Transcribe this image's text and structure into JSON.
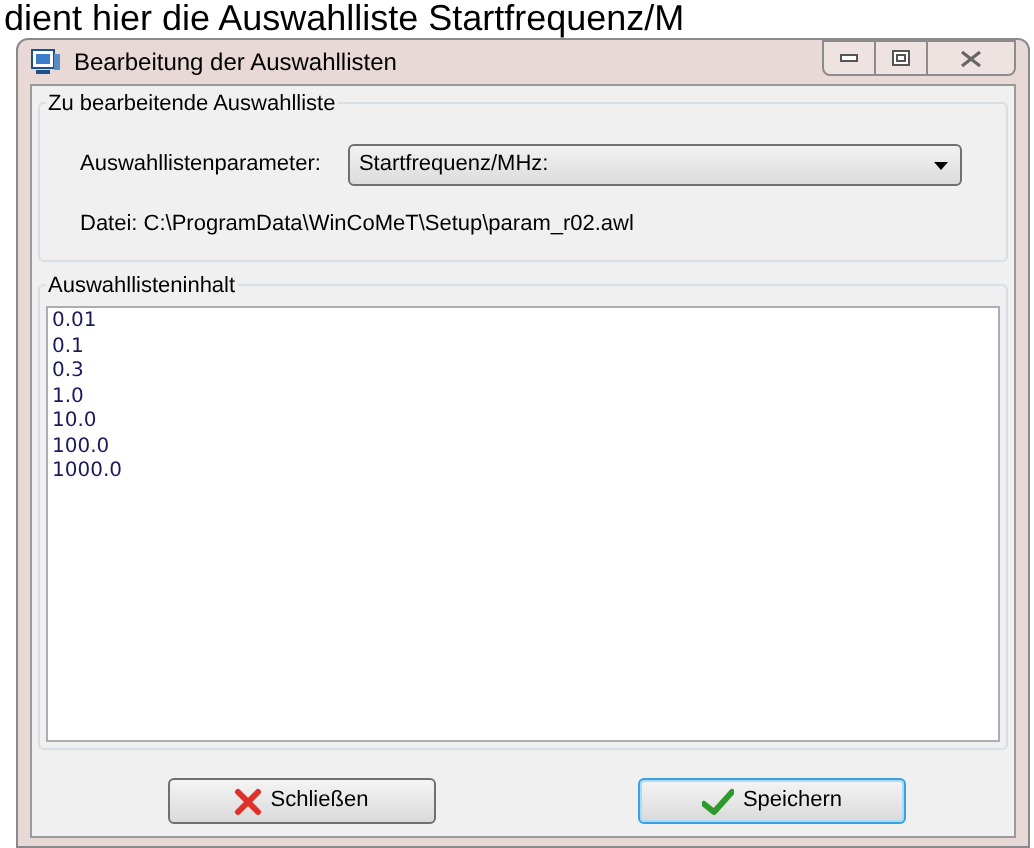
{
  "caption": "dient hier die Auswahlliste Startfrequenz/M",
  "window": {
    "title": "Bearbeitung der Auswahllisten"
  },
  "list_group": {
    "title": "Zu bearbeitende Auswahlliste",
    "parameter_label": "Auswahllistenparameter:",
    "parameter_value": "Startfrequenz/MHz:",
    "file_path": "Datei: C:\\ProgramData\\WinCoMeT\\Setup\\param_r02.awl"
  },
  "content_group": {
    "title": "Auswahllisteninhalt",
    "lines": [
      "0.01",
      "0.1",
      "0.3",
      "1.0",
      "10.0",
      "100.0",
      "1000.0"
    ]
  },
  "buttons": [
    {
      "label": "Schließen",
      "kind": "close",
      "focused": false
    },
    {
      "label": "Speichern",
      "kind": "save",
      "focused": true
    }
  ]
}
